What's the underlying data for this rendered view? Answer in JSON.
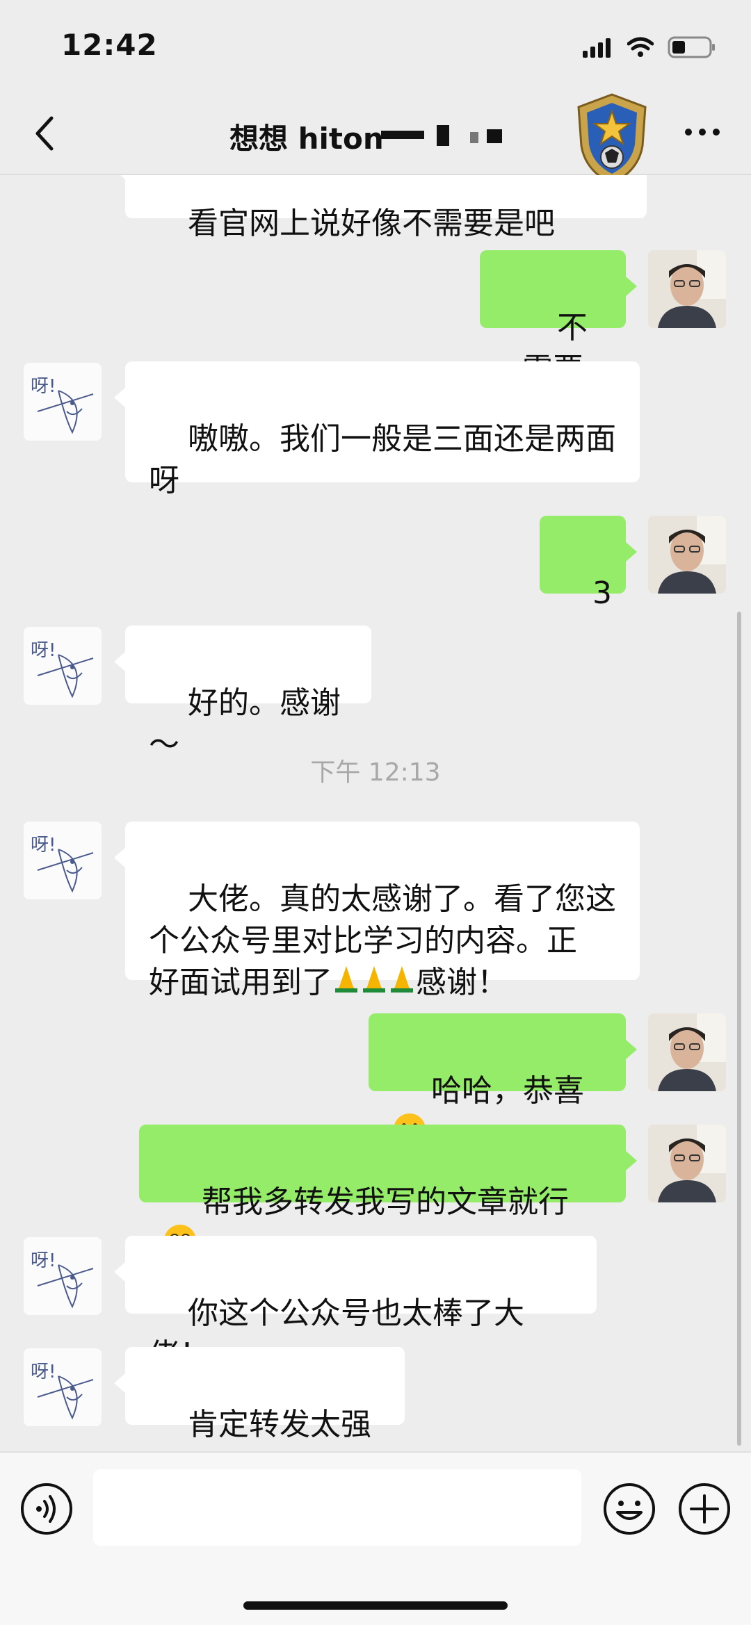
{
  "status_bar": {
    "time": "12:42"
  },
  "nav": {
    "title": "想想 hiton"
  },
  "messages": [
    {
      "side": "in",
      "text": "看官网上说好像不需要是吧"
    },
    {
      "side": "out",
      "text": "不需要"
    },
    {
      "side": "in",
      "text": "嗷嗷。我们一般是三面还是两面\n呀"
    },
    {
      "side": "out",
      "text": "3"
    },
    {
      "side": "in",
      "text": "好的。感谢～"
    },
    {
      "side": "in",
      "text_a": "大佬。真的太感谢了。看了您这\n个公众号里对比学习的内容。正\n好面试用到了",
      "text_b": "感谢！",
      "emoji": "folded-hands x3"
    },
    {
      "side": "out",
      "text": "哈哈，恭喜",
      "emoji": "grinning-face"
    },
    {
      "side": "out",
      "text": "帮我多转发我写的文章就行",
      "emoji": "pleading-face"
    },
    {
      "side": "in",
      "text": "你这个公众号也太棒了大佬！"
    },
    {
      "side": "in",
      "text": "肯定转发太强了"
    }
  ],
  "timestamp": "下午 12:13",
  "avatar_text": "呀!",
  "colors": {
    "background": "#ededed",
    "out_bubble": "#95ec69",
    "in_bubble": "#ffffff"
  }
}
